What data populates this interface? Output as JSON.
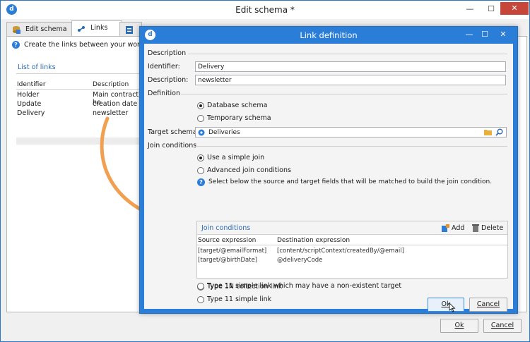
{
  "window": {
    "title": "Edit schema *",
    "app_icon": "d",
    "controls": {
      "minimize": "—",
      "maximize": "☐",
      "close": "✕"
    }
  },
  "tabs": [
    {
      "label": "Edit schema",
      "icon": "database-icon"
    },
    {
      "label": "Links",
      "icon": "link-icon"
    },
    {
      "label": "",
      "icon": "clipboard-icon"
    }
  ],
  "links_pane": {
    "intro": "Create the links between your working",
    "list_title": "List of links",
    "columns": [
      "Identifier",
      "Description"
    ],
    "rows": [
      {
        "identifier": "Holder",
        "description": "Main contract ho"
      },
      {
        "identifier": "Update",
        "description": "creation date"
      },
      {
        "identifier": "Delivery",
        "description": "newsletter"
      }
    ]
  },
  "footer": {
    "ok": "Ok",
    "cancel": "Cancel"
  },
  "dialog": {
    "title": "Link definition",
    "sections": {
      "description": "Description",
      "definition": "Definition",
      "join_conditions": "Join conditions"
    },
    "identifier_label": "Identifier:",
    "identifier_value": "Delivery",
    "description_label": "Description:",
    "description_value": "newsletter",
    "schema_options": [
      "Database schema",
      "Temporary schema"
    ],
    "target_schema_label": "Target schema:",
    "target_schema_value": "Deliveries",
    "join_options": [
      "Use a simple join",
      "Advanced join conditions"
    ],
    "join_hint": "Select below the source and target fields that will be matched to build the join condition.",
    "join_panel": {
      "title": "Join conditions",
      "add": "Add",
      "delete": "Delete",
      "columns": [
        "Source expression",
        "Destination expression"
      ],
      "rows": [
        {
          "source": "[target/@emailFormat]",
          "destination": "[content/scriptContext/createdBy/@email]"
        },
        {
          "source": "[target/@birthDate]",
          "destination": "@deliveryCode"
        }
      ]
    },
    "type_options": [
      "Type 1N collection link",
      "Type 11 simple link",
      "Type 11 simple link which may have a non-existent target"
    ],
    "ok": "Ok",
    "cancel": "Cancel"
  },
  "colors": {
    "accent": "#2b7ed8",
    "close": "#c7463a",
    "arrow": "#f0a050"
  }
}
